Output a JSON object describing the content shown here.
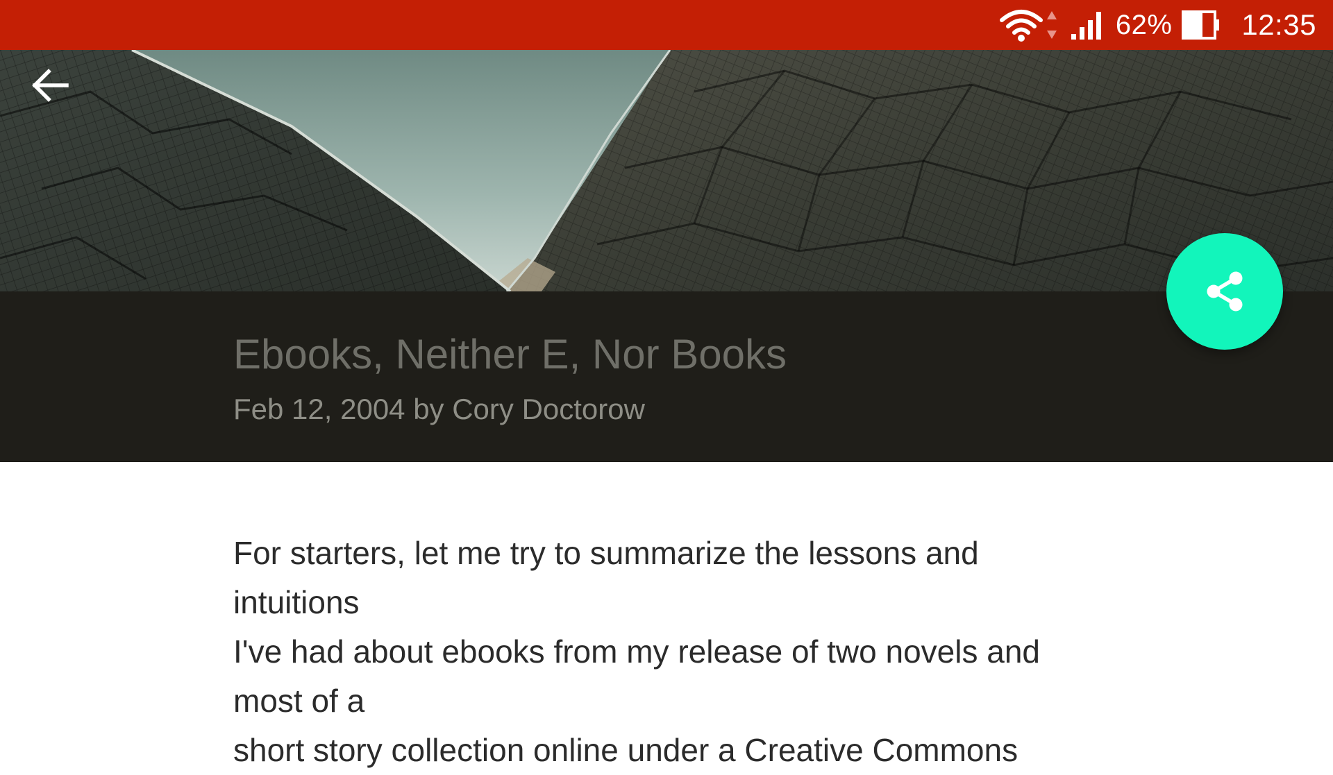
{
  "status_bar": {
    "battery_percent": "62%",
    "time": "12:35",
    "icons": [
      "wifi-icon",
      "data-arrows-icon",
      "signal-icon",
      "battery-icon"
    ]
  },
  "header": {
    "back_icon": "arrow-left-icon"
  },
  "article": {
    "title": "Ebooks, Neither E, Nor Books",
    "meta": "Feb 12, 2004 by Cory Doctorow",
    "lines": [
      "For starters, let me try to summarize the lessons and",
      "intuitions",
      "I've had about ebooks from my release of two novels and",
      "most of a",
      "short story collection online under a Creative Commons"
    ]
  },
  "share_button": {
    "icon": "share-icon"
  },
  "colors": {
    "status_bar": "#c41f05",
    "title_band": "#1f1e19",
    "fab": "#12f5bb",
    "title_text": "#6f6f68",
    "meta_text": "#8e8e86",
    "body_text": "#2b2b2b"
  }
}
